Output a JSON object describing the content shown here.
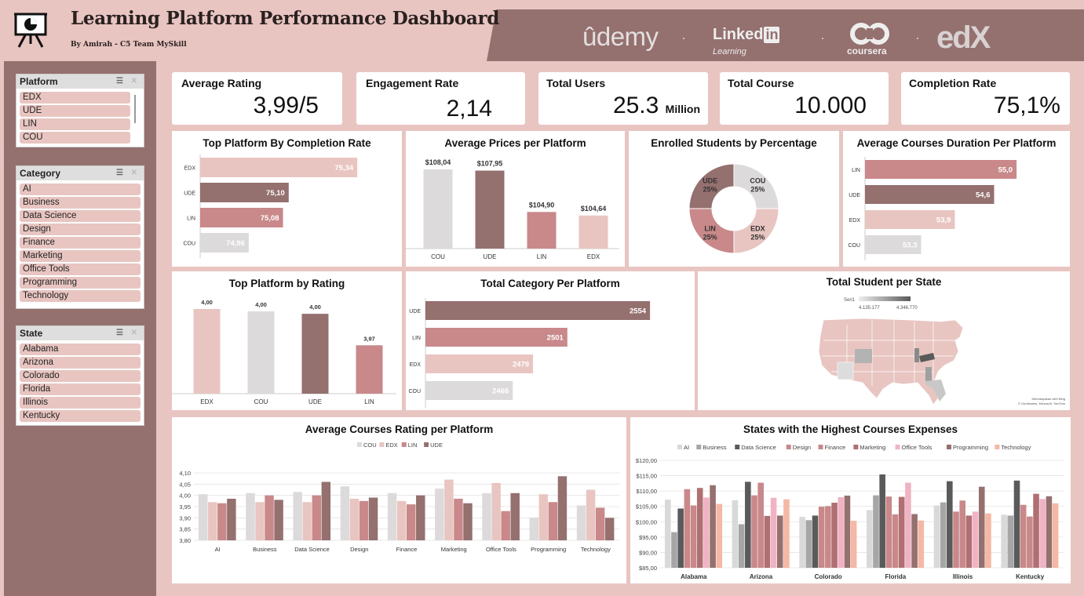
{
  "header": {
    "title": "Learning Platform Performance Dashboard",
    "author": "By Amirah -  C5 Team MySkill",
    "brands": {
      "udemy": "ûdemy",
      "linkedin": "Linked",
      "linkedin_in": "in",
      "linkedin_sub": "Learning",
      "coursera": "coursera",
      "edx": "edX"
    }
  },
  "slicers": {
    "platform": {
      "title": "Platform",
      "items": [
        "EDX",
        "UDE",
        "LIN",
        "COU"
      ]
    },
    "category": {
      "title": "Category",
      "items": [
        "AI",
        "Business",
        "Data Science",
        "Design",
        "Finance",
        "Marketing",
        "Office Tools",
        "Programming",
        "Technology"
      ]
    },
    "state": {
      "title": "State",
      "items": [
        "Alabama",
        "Arizona",
        "Colorado",
        "Florida",
        "Illinois",
        "Kentucky"
      ]
    }
  },
  "kpis": {
    "avg_rating": {
      "label": "Average Rating",
      "value": "3,99/5"
    },
    "engagement": {
      "label": "Engagement Rate",
      "value": "2,14"
    },
    "users": {
      "label": "Total Users",
      "value": "25.3",
      "unit": "Million"
    },
    "courses": {
      "label": "Total Course",
      "value": "10.000"
    },
    "completion": {
      "label": "Completion Rate",
      "value": "75,1%"
    }
  },
  "colors": {
    "light_pink": "#e8c5c1",
    "mauve": "#94706f",
    "rose": "#c9888a",
    "grey": "#dcdada",
    "dark": "#5a5a5a"
  },
  "chart_data": [
    {
      "id": "completion",
      "type": "bar",
      "orientation": "horizontal",
      "title": "Top Platform By Completion Rate",
      "categories": [
        "EDX",
        "UDE",
        "LIN",
        "COU"
      ],
      "values": [
        75.34,
        75.1,
        75.08,
        74.96
      ],
      "labels": [
        "75,34",
        "75,10",
        "75,08",
        "74,96"
      ],
      "colors": [
        "#e8c5c1",
        "#94706f",
        "#c9888a",
        "#dcdada"
      ]
    },
    {
      "id": "prices",
      "type": "bar",
      "title": "Average Prices per Platform",
      "categories": [
        "COU",
        "UDE",
        "LIN",
        "EDX"
      ],
      "values": [
        108.04,
        107.95,
        104.9,
        104.64
      ],
      "labels": [
        "$108,04",
        "$107,95",
        "$104,90",
        "$104,64"
      ],
      "colors": [
        "#dcdada",
        "#94706f",
        "#c9888a",
        "#e8c5c1"
      ]
    },
    {
      "id": "enrolled",
      "type": "pie",
      "title": "Enrolled Students by Percentage",
      "categories": [
        "COU",
        "EDX",
        "LIN",
        "UDE"
      ],
      "values": [
        25,
        25,
        25,
        25
      ],
      "labels": [
        "25%",
        "25%",
        "25%",
        "25%"
      ],
      "colors": [
        "#dcdada",
        "#e8c5c1",
        "#c9888a",
        "#94706f"
      ]
    },
    {
      "id": "duration",
      "type": "bar",
      "orientation": "horizontal",
      "title": "Average Courses Duration Per Platform",
      "categories": [
        "LIN",
        "UDE",
        "EDX",
        "COU"
      ],
      "values": [
        55.0,
        54.6,
        53.9,
        53.3
      ],
      "labels": [
        "55,0",
        "54,6",
        "53,9",
        "53,3"
      ],
      "colors": [
        "#c9888a",
        "#94706f",
        "#e8c5c1",
        "#dcdada"
      ]
    },
    {
      "id": "rating",
      "type": "bar",
      "title": "Top Platform by Rating",
      "categories": [
        "EDX",
        "COU",
        "UDE",
        "LIN"
      ],
      "values": [
        4.0,
        3.998,
        3.996,
        3.97
      ],
      "labels": [
        "4,00",
        "4,00",
        "4,00",
        "3,97"
      ],
      "colors": [
        "#e8c5c1",
        "#dcdada",
        "#94706f",
        "#c9888a"
      ]
    },
    {
      "id": "category_total",
      "type": "bar",
      "orientation": "horizontal",
      "title": "Total Category Per Platform",
      "categories": [
        "UDE",
        "LIN",
        "EDX",
        "COU"
      ],
      "values": [
        2554,
        2501,
        2479,
        2466
      ],
      "labels": [
        "2554",
        "2501",
        "2479",
        "2466"
      ],
      "colors": [
        "#94706f",
        "#c9888a",
        "#e8c5c1",
        "#dcdada"
      ]
    },
    {
      "id": "map",
      "type": "map",
      "title": "Total Student per State",
      "legend_series": "Seri1",
      "legend_min": "4.135.177",
      "legend_max": "4.346.770",
      "credit_1": "Diberdayakan oleh Bing",
      "credit_2": "© GeoNames, Microsoft, TomTom"
    },
    {
      "id": "avg_rating_category",
      "type": "bar",
      "title": "Average Courses Rating per Platform",
      "categories": [
        "AI",
        "Business",
        "Data Science",
        "Design",
        "Finance",
        "Marketing",
        "Office Tools",
        "Programming",
        "Technology"
      ],
      "ylim": [
        3.8,
        4.1
      ],
      "yticks": [
        "3,80",
        "3,85",
        "3,90",
        "3,95",
        "4,00",
        "4,05",
        "4,10"
      ],
      "series": [
        {
          "name": "COU",
          "color": "#dcdada",
          "values": [
            4.005,
            4.01,
            4.015,
            4.04,
            4.01,
            4.03,
            4.01,
            3.9,
            3.955
          ]
        },
        {
          "name": "EDX",
          "color": "#e8c5c1",
          "values": [
            3.97,
            3.97,
            3.97,
            3.985,
            3.975,
            4.07,
            4.055,
            4.005,
            4.025
          ]
        },
        {
          "name": "LIN",
          "color": "#c9888a",
          "values": [
            3.965,
            4.0,
            4.0,
            3.975,
            3.96,
            3.985,
            3.93,
            3.97,
            3.945
          ]
        },
        {
          "name": "UDE",
          "color": "#94706f",
          "values": [
            3.985,
            3.98,
            4.06,
            3.99,
            4.0,
            3.965,
            4.01,
            4.085,
            3.9
          ]
        }
      ]
    },
    {
      "id": "state_expenses",
      "type": "bar",
      "title": "States with the Highest Courses Expenses",
      "categories": [
        "Alabama",
        "Arizona",
        "Colorado",
        "Florida",
        "Illinois",
        "Kentucky"
      ],
      "ylim": [
        85,
        120
      ],
      "yticks": [
        "$85,00",
        "$90,00",
        "$95,00",
        "$100,00",
        "$105,00",
        "$110,00",
        "$115,00",
        "$120,00"
      ],
      "series": [
        {
          "name": "AI",
          "color": "#d9d9d9",
          "values": [
            107.2,
            107.0,
            101.6,
            103.8,
            105.3,
            102.3
          ]
        },
        {
          "name": "Business",
          "color": "#a6a6a6",
          "values": [
            96.6,
            99.2,
            100.5,
            108.6,
            106.3,
            102.0
          ]
        },
        {
          "name": "Data Science",
          "color": "#5a5a5a",
          "values": [
            104.3,
            113.0,
            102.0,
            115.4,
            113.2,
            113.4
          ]
        },
        {
          "name": "Design",
          "color": "#c9888a",
          "values": [
            110.6,
            108.6,
            104.9,
            108.2,
            103.3,
            105.5
          ]
        },
        {
          "name": "Finance",
          "color": "#c9888a",
          "values": [
            105.3,
            112.7,
            105.1,
            102.4,
            106.9,
            101.7
          ]
        },
        {
          "name": "Marketing",
          "color": "#b06f72",
          "values": [
            111.0,
            101.9,
            106.2,
            108.1,
            102.0,
            109.1
          ]
        },
        {
          "name": "Office Tools",
          "color": "#f0b3c3",
          "values": [
            107.9,
            107.8,
            108.0,
            112.7,
            103.3,
            107.4
          ]
        },
        {
          "name": "Programming",
          "color": "#94706f",
          "values": [
            111.9,
            102.0,
            108.5,
            102.5,
            111.4,
            108.3
          ]
        },
        {
          "name": "Technology",
          "color": "#f4b8a5",
          "values": [
            105.8,
            107.3,
            100.3,
            100.4,
            102.7,
            106.0
          ]
        }
      ]
    }
  ]
}
